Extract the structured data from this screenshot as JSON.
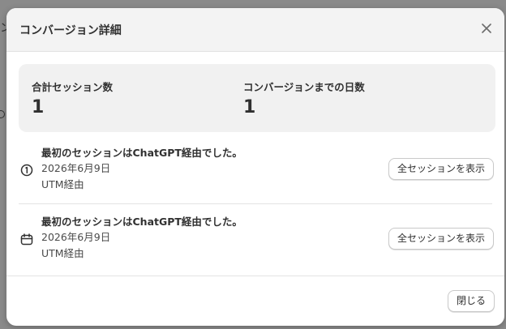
{
  "backdrop": {
    "partial_text": "ン"
  },
  "modal": {
    "title": "コンバージョン詳細",
    "close_icon": "close-icon"
  },
  "stats": {
    "total_sessions_label": "合計セッション数",
    "total_sessions_value": "1",
    "days_to_conversion_label": "コンバージョンまでの日数",
    "days_to_conversion_value": "1"
  },
  "sessions": [
    {
      "icon": "first-session-icon",
      "headline": "最初のセッションはChatGPT経由でした。",
      "date": "2026年6月9日",
      "source": "UTM経由",
      "button_label": "全セッションを表示"
    },
    {
      "icon": "calendar-icon",
      "headline": "最初のセッションはChatGPT経由でした。",
      "date": "2026年6月9日",
      "source": "UTM経由",
      "button_label": "全セッションを表示"
    }
  ],
  "footer": {
    "close_button_label": "閉じる"
  }
}
